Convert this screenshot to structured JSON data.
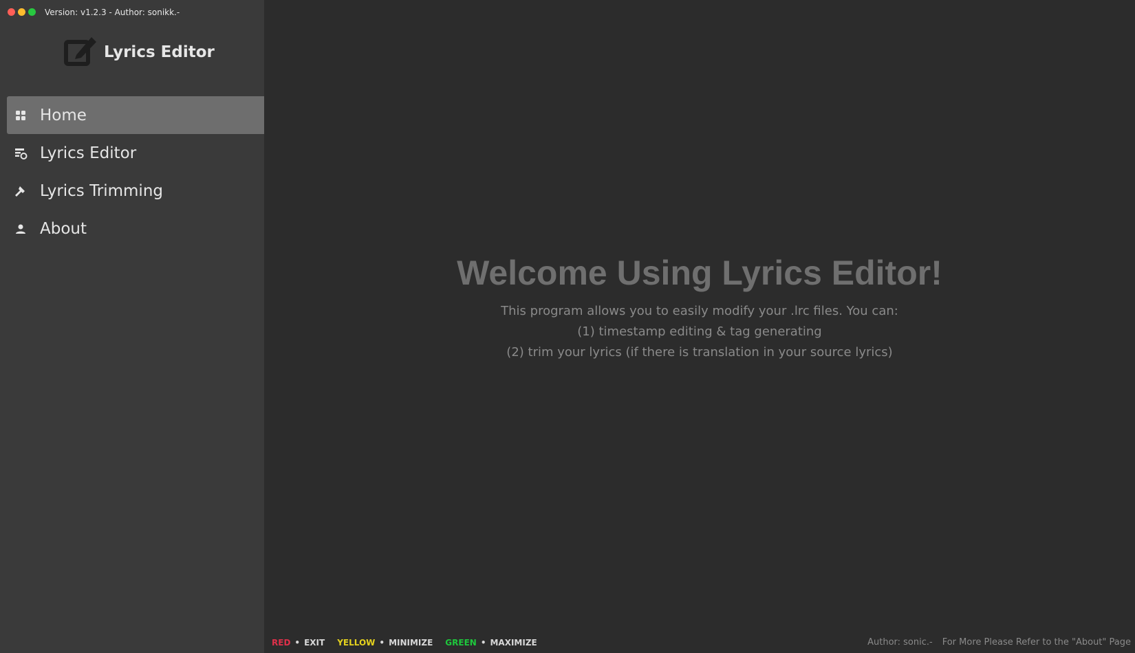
{
  "window": {
    "version_text": "Version: v1.2.3 - Author: sonikk.-"
  },
  "brand": {
    "icon": "edit-square-icon",
    "title": "Lyrics Editor"
  },
  "sidebar": {
    "items": [
      {
        "label": "Home",
        "icon": "grid-icon",
        "active": true
      },
      {
        "label": "Lyrics Editor",
        "icon": "edit-list-icon",
        "active": false
      },
      {
        "label": "Lyrics Trimming",
        "icon": "hammer-icon",
        "active": false
      },
      {
        "label": "About",
        "icon": "person-icon",
        "active": false
      }
    ]
  },
  "main": {
    "title": "Welcome Using Lyrics Editor!",
    "lines": [
      "This program allows you to easily modify your .lrc files. You can:",
      "(1) timestamp editing & tag generating",
      "(2) trim your lyrics (if there is translation in your source lyrics)"
    ]
  },
  "footer": {
    "legend": [
      {
        "color": "RED",
        "action": "EXIT"
      },
      {
        "color": "YELLOW",
        "action": "MINIMIZE"
      },
      {
        "color": "GREEN",
        "action": "MAXIMIZE"
      }
    ],
    "bullet": "•",
    "author": "Author: sonic.-",
    "more": "For More Please Refer to the \"About\" Page"
  },
  "colors": {
    "accent_red": "#e0304a",
    "accent_yellow": "#e5d21e",
    "accent_green": "#1ec83c",
    "sidebar_bg": "#3a3a3a",
    "main_bg": "#2c2c2c",
    "active_item": "#6e6e6e"
  }
}
